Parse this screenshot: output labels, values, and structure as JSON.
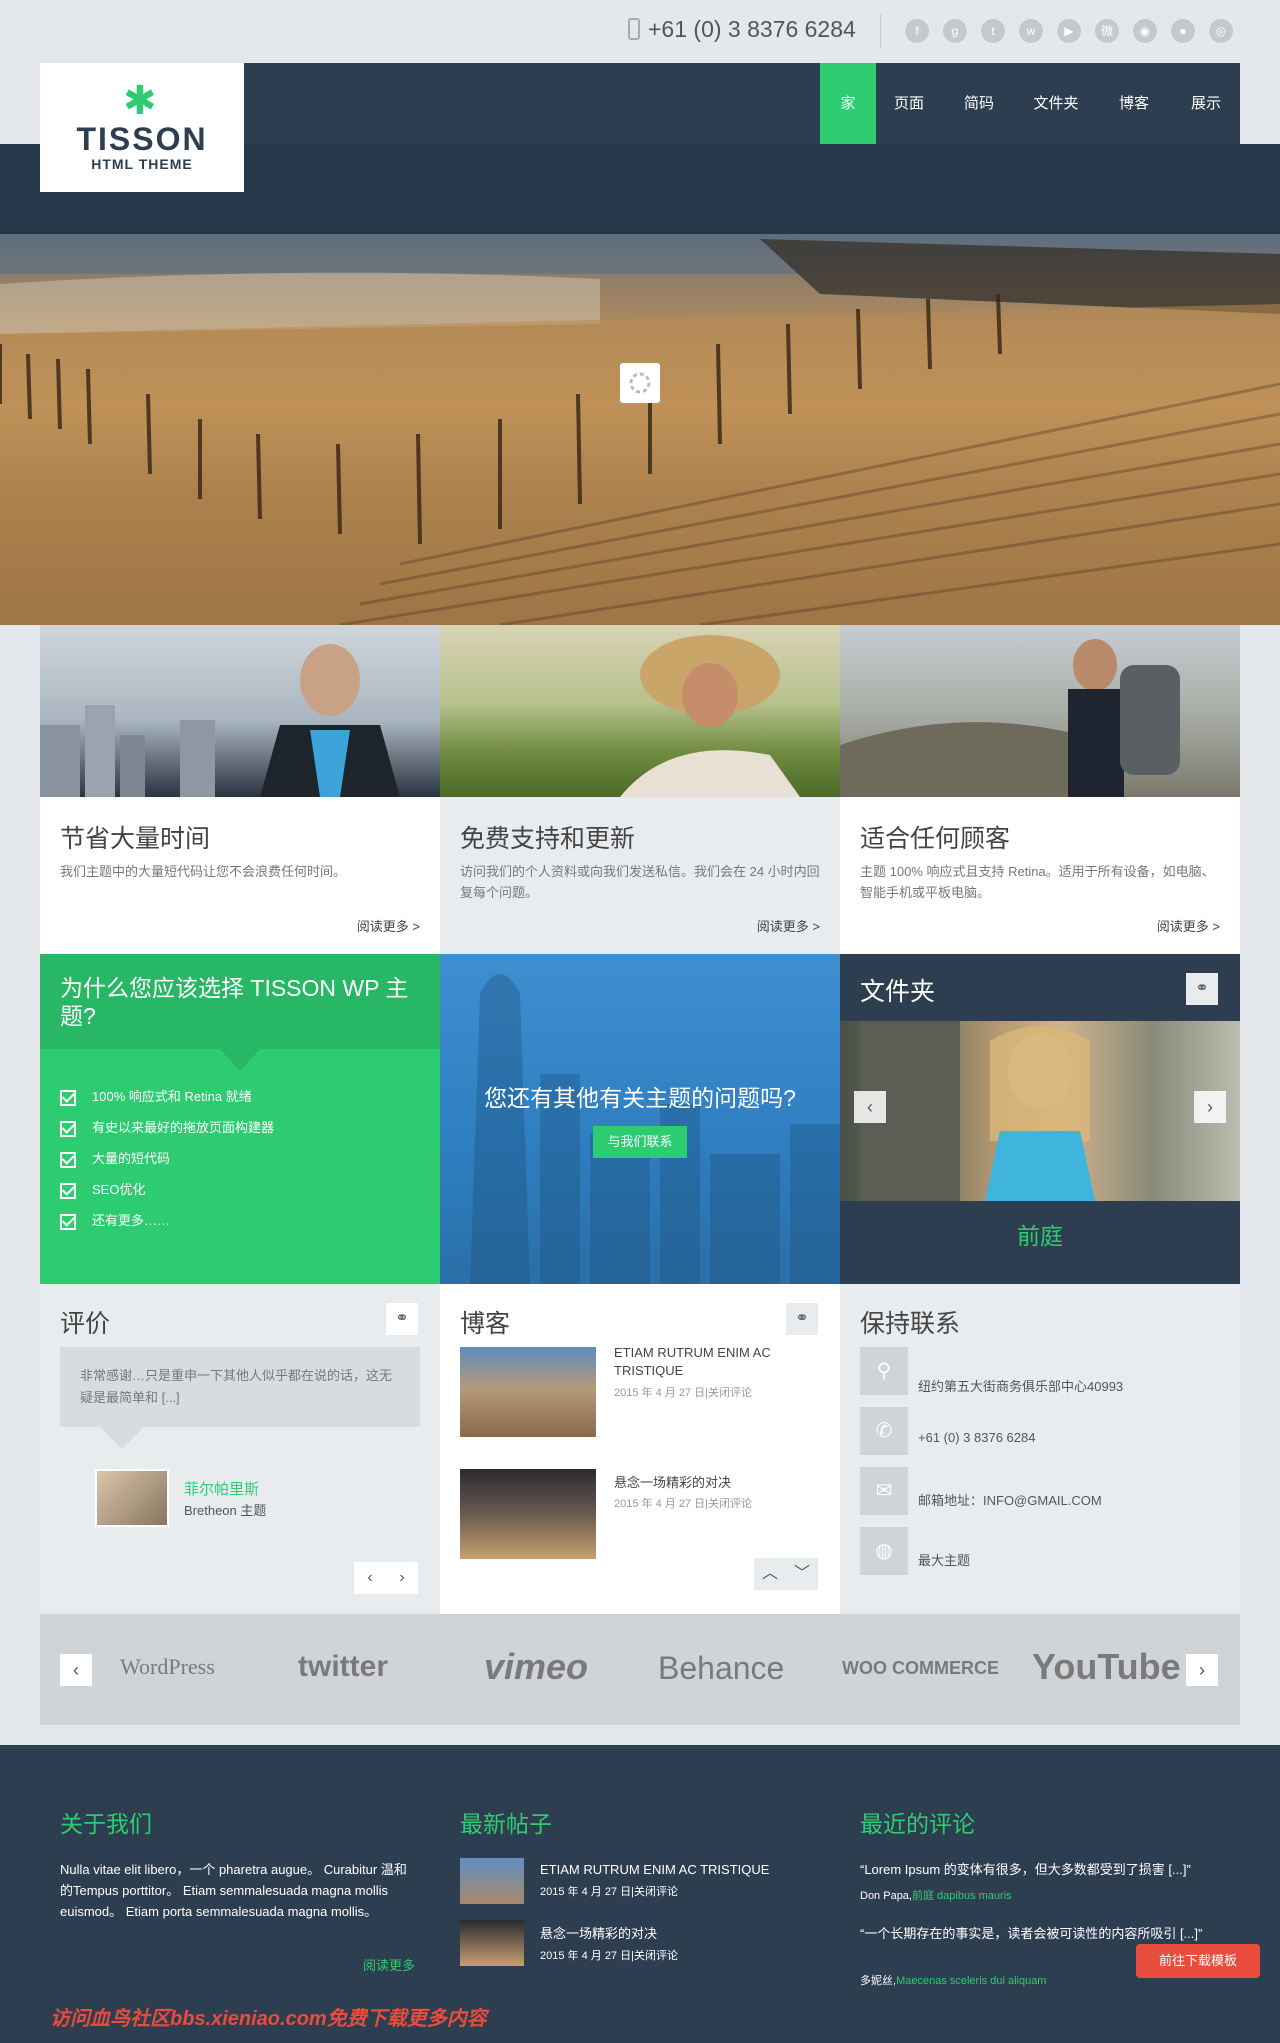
{
  "topbar": {
    "phone": "+61 (0) 3 8376 6284",
    "social_icons": [
      "facebook-icon",
      "google-plus-icon",
      "tumblr-icon",
      "wechat-icon",
      "youtube-icon",
      "weibo-icon",
      "rss-icon",
      "flickr-icon",
      "dribbble-icon"
    ]
  },
  "logo": {
    "mark": "✱",
    "name": "TISSON",
    "sub": "HTML THEME"
  },
  "nav": {
    "items": [
      "家",
      "页面",
      "简码",
      "文件夹",
      "博客",
      "展示"
    ],
    "active": "家"
  },
  "features": [
    {
      "title": "节省大量时间",
      "text": "我们主题中的大量短代码让您不会浪费任何时间。",
      "more": "阅读更多 >"
    },
    {
      "title": "免费支持和更新",
      "text": "访问我们的个人资料或向我们发送私信。我们会在 24 小时内回复每个问题。",
      "more": "阅读更多 >"
    },
    {
      "title": "适合任何顾客",
      "text": "主题 100% 响应式且支持 Retina。适用于所有设备，如电脑、智能手机或平板电脑。",
      "more": "阅读更多 >"
    }
  ],
  "why": {
    "title": "为什么您应该选择 TISSON WP 主题?",
    "items": [
      "100% 响应式和 Retina 就绪",
      "有史以来最好的拖放页面构建器",
      "大量的短代码",
      "SEO优化",
      "还有更多……"
    ]
  },
  "question": {
    "text": "您还有其他有关主题的问题吗?",
    "button": "与我们联系"
  },
  "folder": {
    "title": "文件夹",
    "caption": "前庭"
  },
  "reviews": {
    "title": "评价",
    "quote": "非常感谢…只是重申一下其他人似乎都在说的话，这无疑是最简单和 [...]",
    "name": "菲尔帕里斯",
    "role": "Bretheon 主题"
  },
  "blog": {
    "title": "博客",
    "posts": [
      {
        "title": "ETIAM RUTRUM ENIM AC TRISTIQUE",
        "date": "2015 年 4 月 27 日|关闭评论"
      },
      {
        "title": "悬念一场精彩的对决",
        "date": "2015 年 4 月 27 日|关闭评论"
      }
    ]
  },
  "contact": {
    "title": "保持联系",
    "address": "纽约第五大街商务俱乐部中心40993",
    "phone": "+61 (0) 3 8376 6284",
    "email": "邮箱地址：INFO@GMAIL.COM",
    "site": "最大主题"
  },
  "partners": {
    "logos": [
      "WordPress",
      "twitter",
      "vimeo",
      "Behance",
      "WOO COMMERCE",
      "YouTube"
    ]
  },
  "footer": {
    "about_title": "关于我们",
    "about_text": "Nulla vitae elit libero，一个 pharetra augue。 Curabitur 温和的Tempus porttitor。 Etiam semmalesuada magna mollis euismod。 Etiam porta semmalesuada magna mollis。",
    "about_more": "阅读更多",
    "posts_title": "最新帖子",
    "posts": [
      {
        "title": "ETIAM RUTRUM ENIM AC TRISTIQUE",
        "date": "2015 年 4 月 27 日|关闭评论"
      },
      {
        "title": "悬念一场精彩的对决",
        "date": "2015 年 4 月 27 日|关闭评论"
      }
    ],
    "comments_title": "最近的评论",
    "comments": [
      {
        "text": "“Lorem Ipsum 的变体有很多，但大多数都受到了损害 [...]”",
        "author": "Don Papa,",
        "link": "前庭 dapibus mauris"
      },
      {
        "text": "“一个长期存在的事实是，读者会被可读性的内容所吸引 [...]”",
        "author": "多妮丝,",
        "link": "Maecenas sceleris dui aliquam"
      }
    ]
  },
  "download_button": "前往下载模板",
  "watermark": "访问血鸟社区bbs.xieniao.com免费下载更多内容",
  "colors": {
    "accent": "#2ecc71",
    "navy": "#2d3e50",
    "blue": "#2f7fc2",
    "badge": "#e74c3c"
  }
}
